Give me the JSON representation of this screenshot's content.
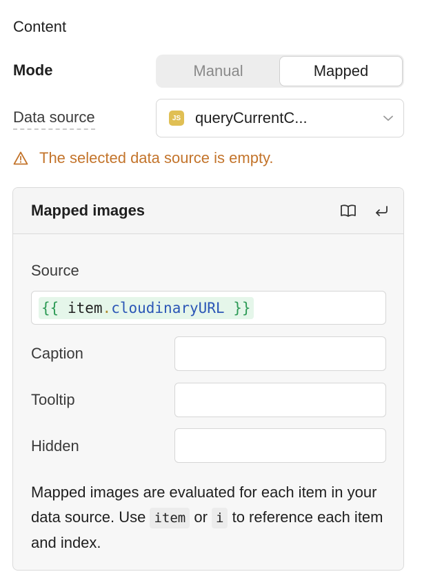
{
  "content": {
    "title": "Content"
  },
  "mode": {
    "label": "Mode",
    "options": [
      "Manual",
      "Mapped"
    ],
    "selected": "Mapped"
  },
  "data_source": {
    "label": "Data source",
    "badge": "JS",
    "value": "queryCurrentC..."
  },
  "warning": {
    "text": "The selected data source is empty."
  },
  "panel": {
    "title": "Mapped images",
    "source": {
      "label": "Source",
      "open_brace": "{{",
      "item": "item",
      "dot": ".",
      "prop": "cloudinaryURL",
      "close_brace": "}}"
    },
    "caption": {
      "label": "Caption",
      "value": ""
    },
    "tooltip": {
      "label": "Tooltip",
      "value": ""
    },
    "hidden": {
      "label": "Hidden",
      "value": ""
    },
    "help": {
      "part1": "Mapped images are evaluated for each item in your data source. Use",
      "code1": "item",
      "part2": "or",
      "code2": "i",
      "part3": "to reference each item and index."
    }
  },
  "icons": {
    "docs": "book-icon",
    "wrap": "return-arrow-icon",
    "warning": "warning-triangle-icon",
    "chevron": "chevron-down-icon"
  },
  "colors": {
    "warning": "#c3742b",
    "js_badge": "#e0bf54",
    "code_chip": "#e5f6ea"
  }
}
